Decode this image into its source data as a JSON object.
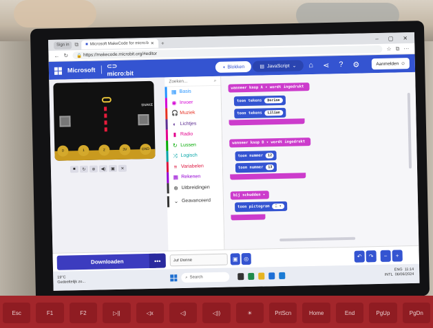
{
  "browser": {
    "tabs": [
      "Sign in",
      "Microsoft MakeCode for micro:b"
    ],
    "url": "https://makecode.microbit.org/#editor"
  },
  "header": {
    "brand": "Microsoft",
    "product": "micro:bit",
    "mode_blocks": "Blokken",
    "mode_js": "JavaScript",
    "signin": "Aanmelden"
  },
  "simulator": {
    "pins": [
      "0",
      "1",
      "2",
      "3V",
      "GND"
    ],
    "label_snake": "SNAKE",
    "controls": [
      "■",
      "↻",
      "⊗",
      "◀)",
      "▣",
      "✕"
    ]
  },
  "toolbox": {
    "search_placeholder": "Zoeken...",
    "categories": [
      {
        "label": "Basis",
        "color": "#1e90ff",
        "icon": "▦"
      },
      {
        "label": "Invoer",
        "color": "#d400d4",
        "icon": "◉"
      },
      {
        "label": "Muziek",
        "color": "#e63022",
        "icon": "🎧"
      },
      {
        "label": "Lichtjes",
        "color": "#5c2d91",
        "icon": "◐"
      },
      {
        "label": "Radio",
        "color": "#e3008c",
        "icon": "▮"
      },
      {
        "label": "Lussen",
        "color": "#00aa00",
        "icon": "↻"
      },
      {
        "label": "Logisch",
        "color": "#00a4a6",
        "icon": "⤨"
      },
      {
        "label": "Variabelen",
        "color": "#dc143c",
        "icon": "≡"
      },
      {
        "label": "Rekenen",
        "color": "#9400d3",
        "icon": "▦"
      },
      {
        "label": "Uitbreidingen",
        "color": "#333333",
        "icon": "⊕"
      },
      {
        "label": "Geavanceerd",
        "color": "#333333",
        "icon": "⌄"
      }
    ]
  },
  "blocks": {
    "event_a": {
      "text": "wanneer knop A ▾ wordt ingedrukt"
    },
    "show_a1": {
      "label": "toon tekens",
      "value": "Dorine"
    },
    "show_a2": {
      "label": "toon tekens",
      "value": "Lilian"
    },
    "event_b": {
      "text": "wanneer knop B ▾ wordt ingedrukt"
    },
    "show_b1": {
      "label": "toon nummer",
      "value": "12"
    },
    "show_b2": {
      "label": "toon nummer",
      "value": "13"
    },
    "event_shake": {
      "text": "bij schudden ▾"
    },
    "show_icon": {
      "label": "toon pictogram"
    }
  },
  "bottom": {
    "download": "Downloaden",
    "more": "•••",
    "project_name": "Juf Dorine"
  },
  "taskbar": {
    "weather_temp": "19°C",
    "weather_text": "Gedeeltelijk zo...",
    "search": "Search",
    "lang": "ENG",
    "lang2": "INTL",
    "time": "11:14",
    "date": "06/06/2024"
  },
  "keyboard": {
    "keys": [
      "Esc",
      "F1",
      "F2",
      "▷||",
      "◁x",
      "◁)",
      "◁))",
      "☀",
      "PrtScn",
      "Home",
      "End",
      "PgUp",
      "PgDn"
    ]
  }
}
